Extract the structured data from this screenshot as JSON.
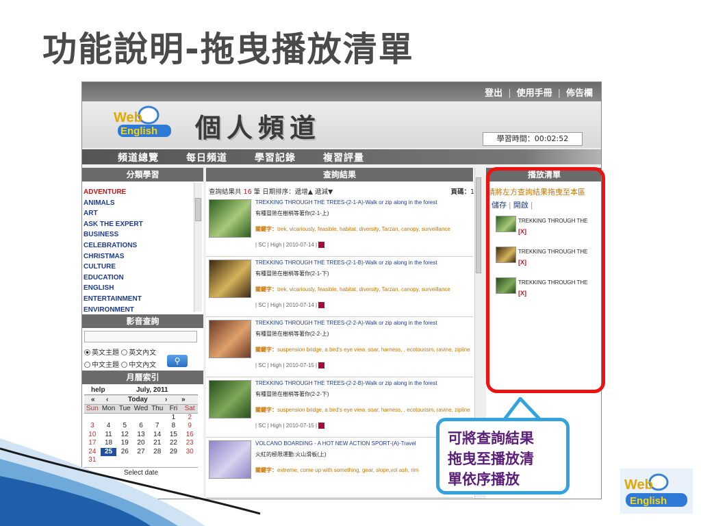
{
  "slide": {
    "title": "功能說明-拖曳播放清單",
    "callout": [
      "可將查詢結果",
      "拖曳至播放清",
      "單依序播放"
    ],
    "corner_logo": {
      "line1": "Web",
      "line2": "English"
    }
  },
  "header": {
    "links": [
      "登出",
      "使用手冊",
      "佈告欄"
    ],
    "logo": {
      "line1": "Web",
      "line2": "English"
    },
    "title": "個人頻道",
    "study_time": "學習時間：00:02:52"
  },
  "nav": [
    "頻道總覽",
    "每日頻道",
    "學習記錄",
    "複習評量"
  ],
  "left": {
    "categories_header": "分類學習",
    "categories": [
      "ADVENTURE",
      "ANIMALS",
      "ART",
      "ASK THE EXPERT",
      "BUSINESS",
      "CELEBRATIONS",
      "CHRISTMAS",
      "CULTURE",
      "EDUCATION",
      "ENGLISH",
      "ENTERTAINMENT",
      "ENVIRONMENT"
    ],
    "search_header": "影音查詢",
    "radio": {
      "en_topic": "英文主題",
      "en_content": "英文內文",
      "zh_topic": "中文主題",
      "zh_content": "中文內文"
    },
    "calendar_header": "月曆索引",
    "calendar": {
      "help": "help",
      "month": "July, 2011",
      "prev_year": "«",
      "prev_month": "‹",
      "today": "Today",
      "next_month": "›",
      "next_year": "»",
      "weekdays": [
        "Sun",
        "Mon",
        "Tue",
        "Wed",
        "Thu",
        "Fri",
        "Sat"
      ],
      "weeks": [
        [
          "",
          "",
          "",
          "",
          "",
          "1",
          "2"
        ],
        [
          "3",
          "4",
          "5",
          "6",
          "7",
          "8",
          "9"
        ],
        [
          "10",
          "11",
          "12",
          "13",
          "14",
          "15",
          "16"
        ],
        [
          "17",
          "18",
          "19",
          "20",
          "21",
          "22",
          "23"
        ],
        [
          "24",
          "25",
          "26",
          "27",
          "28",
          "29",
          "30"
        ],
        [
          "31",
          "",
          "",
          "",
          "",
          "",
          ""
        ]
      ],
      "today_date": "25",
      "select_date": "Select date"
    }
  },
  "middle": {
    "header": "查詢結果",
    "summary_prefix": "查詢結果共",
    "count": "16",
    "summary_suffix": "筆 日期排序：遞增▲ 遞減▼",
    "page_label": "頁碼：",
    "page": "1",
    "results": [
      {
        "title": "TREKKING THROUGH THE TREES-(2-1-A)-Walk or zip along in the forest",
        "zh": "有種冒險在樹梢等著你(2-1-上)",
        "kw_label": "關鍵字：",
        "kw": "trek, vicariously, feasible, habitat, diversity, Tarzan, canopy, surveillance",
        "meta": "| SC | High | 2010-07-14 |"
      },
      {
        "title": "TREKKING THROUGH THE TREES-(2-1-B)-Walk or zip along in the forest",
        "zh": "有種冒險在樹梢等著你(2-1-下)",
        "kw_label": "關鍵字：",
        "kw": "trek, vicariously, feasible, habitat, diversity, Tarzan, canopy, surveillance",
        "meta": "| SC | High | 2010-07-14 |"
      },
      {
        "title": "TREKKING THROUGH THE TREES-(2-2-A)-Walk or zip along in the forest",
        "zh": "有種冒險在樹梢等著你(2-2-上)",
        "kw_label": "關鍵字：",
        "kw": "suspension bridge, a bird's eye view, soar, harness, , ecotourism, ravine, zipline",
        "meta": "| SC | High | 2010-07-15 |"
      },
      {
        "title": "TREKKING THROUGH THE TREES-(2-2-B)-Walk or zip along in the forest",
        "zh": "有種冒險在樹梢等著你(2-2-下)",
        "kw_label": "關鍵字：",
        "kw": "suspension bridge, a bird's eye view, soar, harness, , ecotourism, ravine, zipline",
        "meta": "| SC | High | 2010-07-15 |"
      },
      {
        "title": "VOLCANO BOARDING - A HOT NEW ACTION SPORT-(A)-Travel",
        "zh": "火紅的極限運動:火山滑板(上)",
        "kw_label": "關鍵字：",
        "kw": "extreme, come up with something, gear, slope,vol ash, rim",
        "meta": ""
      }
    ]
  },
  "right": {
    "header": "播放清單",
    "hint": "請將左方查詢結果拖曳至本區",
    "save": "儲存",
    "open": "開啟",
    "sep": "|",
    "items": [
      {
        "title": "TREKKING THROUGH THE",
        "remove": "[X]"
      },
      {
        "title": "TREKKING THROUGH THE",
        "remove": "[X]"
      },
      {
        "title": "TREKKING THROUGH THE",
        "remove": "[X]"
      }
    ]
  },
  "colors": {
    "highlight": "#ee1111",
    "callout_border": "#33a3e0",
    "callout_text": "#5a1d7a",
    "link_blue": "#1b3a8c",
    "keyword_orange": "#c87400"
  }
}
